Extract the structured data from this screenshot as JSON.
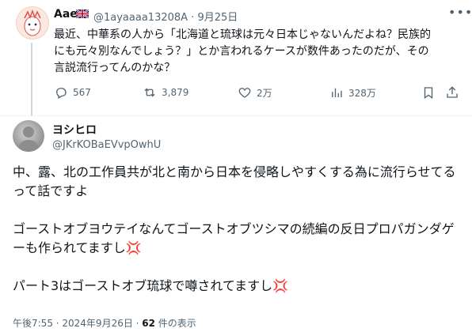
{
  "tweet": {
    "author_name": "Aae",
    "handle_date": "@1ayaaaa13208A · 9月25日",
    "text": "最近、中華系の人から「北海道と琉球は元々日本じゃないんだよね？民族的\nにも元々別なんでしょう？」とか言われるケースが数件あったのだが、その\n言説流行ってんのかな？",
    "replies": "567",
    "retweets": "3,879",
    "likes": "2万",
    "views": "328万"
  },
  "reply": {
    "author_name": "ヨシヒロ",
    "handle": "@JKrKOBaEVvpOwhU",
    "paragraphs": [
      "中、露、北の工作員共が北と南から日本を侵略しやすくする為に流行らせてるって話ですよ",
      "ゴーストオブヨウテイなんてゴーストオブツシマの続編の反日プロパガンダゲーも作られてますし💢",
      "パート3はゴーストオブ琉球で噂されてますし💢"
    ],
    "time_date": "午後7:55 · 2024年9月26日 · ",
    "view_count": "62",
    "views_label": " 件の表示"
  },
  "icons": [
    "more-icon",
    "reply-icon",
    "retweet-icon",
    "like-icon",
    "views-icon",
    "bookmark-icon",
    "share-icon"
  ]
}
